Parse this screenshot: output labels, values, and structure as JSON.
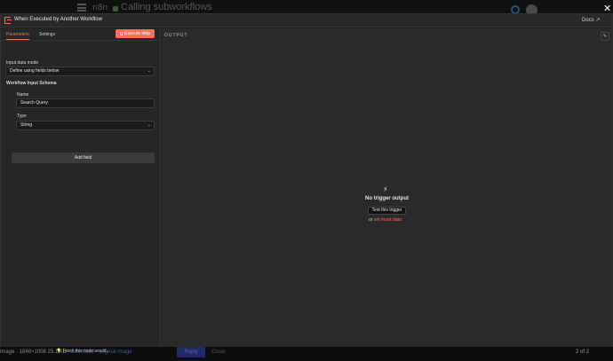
{
  "background": {
    "workflow_title": "Calling subworkflows",
    "logo": "n8n",
    "close": "✕",
    "footer": {
      "meta": "image · 1848×1008 25.1 KB · ",
      "download": "download",
      "sep": " · ",
      "original": "original image",
      "button": "Reply",
      "close": "Close",
      "pager": "2 of 2"
    }
  },
  "node": {
    "title": "When Executed by Another Workflow",
    "docs": "Docs ↗"
  },
  "tabs": [
    {
      "label": "Parameters",
      "active": true
    },
    {
      "label": "Settings",
      "active": false
    }
  ],
  "execute_button": "Execute step",
  "params": {
    "input_mode_label": "Input data mode",
    "input_mode_value": "Define using fields below",
    "schema_heading": "Workflow Input Schema",
    "name_label": "Name",
    "name_value": "Search Query",
    "type_label": "Type",
    "type_value": "String",
    "add_field": "Add field",
    "wish": "I wish this node would..."
  },
  "output": {
    "label": "OUTPUT",
    "empty_title": "No trigger output",
    "test_button": "Test this trigger",
    "or_text": "or",
    "mock_link": "set mock data"
  },
  "icons": {
    "trigger": "trigger-icon",
    "bolt": "⚡",
    "edit": "✎",
    "chevron": "⌄",
    "lightbulb": "lightbulb-icon",
    "flask": "flask-icon",
    "arrow": "‹"
  },
  "colors": {
    "accent": "#ff6d5a",
    "panel": "#262626",
    "output_bg": "#2a2a2a"
  }
}
